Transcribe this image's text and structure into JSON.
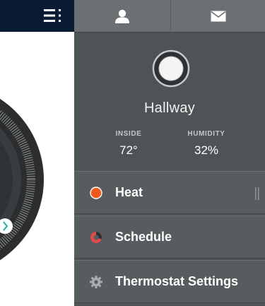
{
  "left_app": {
    "menu_icon": "menu-list-icon",
    "dial_arrow_icon": "chevron-right-icon"
  },
  "panel": {
    "topbar": {
      "profile_icon": "user-icon",
      "mail_icon": "mail-icon"
    },
    "device": {
      "icon": "thermostat-ring-icon",
      "name": "Hallway",
      "inside_label": "INSIDE",
      "inside_value": "72°",
      "humidity_label": "HUMIDITY",
      "humidity_value": "32%"
    },
    "menu": [
      {
        "label": "Heat",
        "icon": "heat-dot-icon",
        "icon_color": "#f05a1a"
      },
      {
        "label": "Schedule",
        "icon": "schedule-icon",
        "icon_color": "#e0484a"
      },
      {
        "label": "Thermostat Settings",
        "icon": "gear-icon"
      }
    ]
  },
  "colors": {
    "panel_bg": "#505557",
    "topbar_bg": "#6b7073",
    "left_topbar_bg": "#0b1a33",
    "heat_accent": "#f05a1a"
  }
}
